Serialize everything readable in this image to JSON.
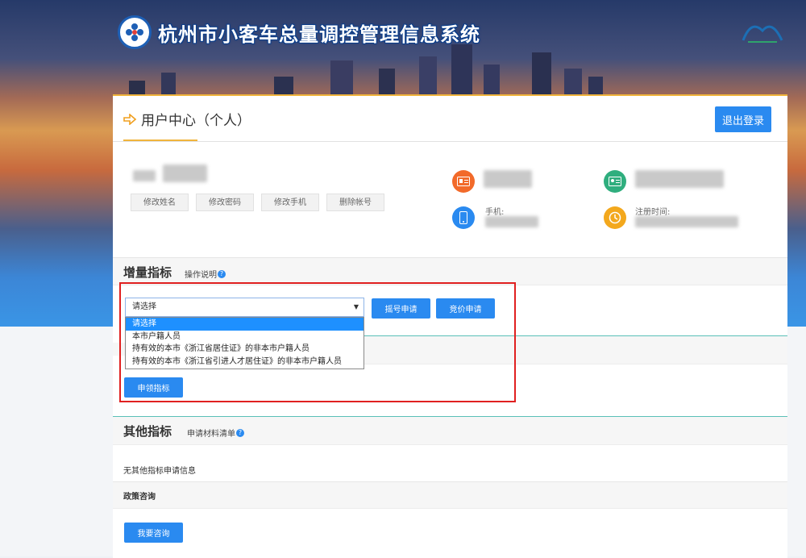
{
  "header": {
    "site_title": "杭州市小客车总量调控管理信息系统"
  },
  "user_center": {
    "title": "用户中心（个人）",
    "logout_label": "退出登录",
    "actions": [
      "修改姓名",
      "修改密码",
      "修改手机",
      "删除帐号"
    ],
    "labels": {
      "phone": "手机:",
      "register_time": "注册时间:"
    }
  },
  "increment": {
    "title": "增量指标",
    "help_link": "操作说明",
    "select": {
      "value": "请选择",
      "options": [
        "请选择",
        "本市户籍人员",
        "持有效的本市《浙江省居住证》的非本市户籍人员",
        "持有效的本市《浙江省引进人才居住证》的非本市户籍人员"
      ]
    },
    "lottery_btn": "摇号申请",
    "bid_btn": "竞价申请",
    "apply_btn": "申领指标"
  },
  "other": {
    "title": "其他指标",
    "help_link": "申请材料清单",
    "empty_text": "无其他指标申请信息"
  },
  "policy": {
    "title": "政策咨询",
    "consult_btn": "我要咨询"
  },
  "colors": {
    "accent": "#2a8af0",
    "highlight": "#f0b43c",
    "alert": "#e02020"
  }
}
